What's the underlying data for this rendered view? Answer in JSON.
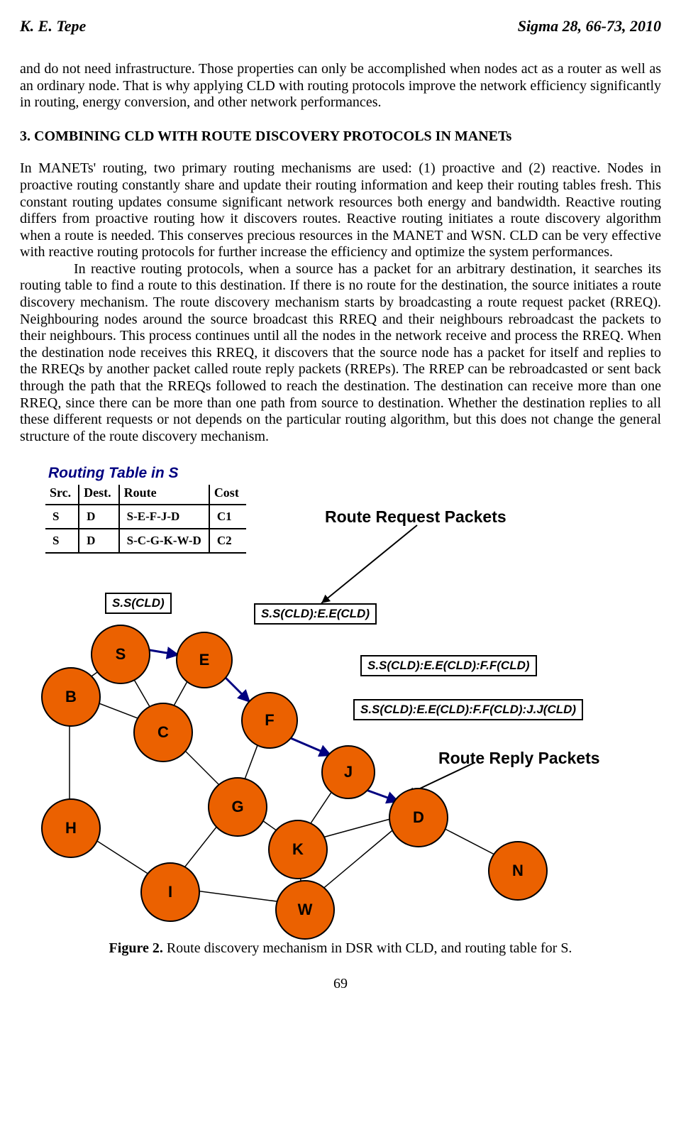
{
  "header": {
    "left": "K. E. Tepe",
    "right": "Sigma 28, 66-73, 2010"
  },
  "body": {
    "p1": "and do not need infrastructure. Those properties can only be accomplished when nodes act as a router as well as an ordinary node. That is why applying CLD with routing protocols improve the network efficiency significantly in routing, energy conversion, and other network performances.",
    "heading": "3. COMBINING CLD WITH ROUTE DISCOVERY PROTOCOLS IN MANETs",
    "p2": "In MANETs' routing, two primary routing mechanisms are used: (1) proactive and (2) reactive. Nodes in proactive routing constantly share and update their routing information and keep their routing tables fresh. This constant routing updates consume significant network resources both energy and bandwidth. Reactive routing differs from proactive routing how it discovers routes. Reactive routing initiates a route discovery algorithm when a route is needed. This conserves precious resources in the MANET and WSN. CLD can be very effective with reactive routing protocols for further increase the efficiency and optimize the system performances.",
    "p3": "In reactive routing protocols, when a source has a packet for an arbitrary destination, it searches its routing table to find a route to this destination. If there is no route for the destination, the source initiates a route discovery mechanism. The route discovery mechanism starts by broadcasting a route request packet (RREQ). Neighbouring nodes around the source broadcast this RREQ and their neighbours rebroadcast the packets to their neighbours. This process continues until all the nodes in the network receive and process the RREQ. When the destination node receives this RREQ, it discovers that the source node has a packet for itself and replies to the RREQs by another packet called route reply packets (RREPs). The RREP can be rebroadcasted or sent back through the path that the RREQs followed to reach the destination. The destination can receive more than one RREQ, since there can be more than one path from source to destination. Whether the destination replies to all these different requests or not depends on the particular routing algorithm, but this does not change the general structure of the route discovery mechanism."
  },
  "figure": {
    "routing_table_title": "Routing Table in S",
    "headers": [
      "Src.",
      "Dest.",
      "Route",
      "Cost"
    ],
    "rows": [
      [
        "S",
        "D",
        "S-E-F-J-D",
        "C1"
      ],
      [
        "S",
        "D",
        "S-C-G-K-W-D",
        "C2"
      ]
    ],
    "rreq_title": "Route Request Packets",
    "rrep_title": "Route Reply Packets",
    "labels": {
      "l1": "S.S(CLD)",
      "l2": "S.S(CLD):E.E(CLD)",
      "l3": "S.S(CLD):E.E(CLD):F.F(CLD)",
      "l4": "S.S(CLD):E.E(CLD):F.F(CLD):J.J(CLD)"
    },
    "nodes": [
      "S",
      "E",
      "F",
      "J",
      "B",
      "C",
      "G",
      "K",
      "H",
      "I",
      "W",
      "D",
      "N"
    ]
  },
  "caption": {
    "label": "Figure 2.",
    "text": " Route discovery mechanism in DSR with CLD, and routing table for S."
  },
  "pagenum": "69",
  "chart_data": {
    "type": "diagram",
    "description": "Network graph showing route discovery (RREQ / RREP) with CLD annotations, plus a routing table for node S.",
    "routing_table": {
      "columns": [
        "Src.",
        "Dest.",
        "Route",
        "Cost"
      ],
      "rows": [
        {
          "Src.": "S",
          "Dest.": "D",
          "Route": "S-E-F-J-D",
          "Cost": "C1"
        },
        {
          "Src.": "S",
          "Dest.": "D",
          "Route": "S-C-G-K-W-D",
          "Cost": "C2"
        }
      ]
    },
    "nodes": [
      "S",
      "E",
      "F",
      "J",
      "D",
      "B",
      "C",
      "G",
      "K",
      "H",
      "I",
      "W",
      "N"
    ],
    "edges_undirected": [
      [
        "S",
        "B"
      ],
      [
        "B",
        "H"
      ],
      [
        "H",
        "I"
      ],
      [
        "I",
        "W"
      ],
      [
        "W",
        "K"
      ],
      [
        "K",
        "G"
      ],
      [
        "G",
        "C"
      ],
      [
        "C",
        "B"
      ],
      [
        "C",
        "E"
      ],
      [
        "C",
        "S"
      ],
      [
        "G",
        "I"
      ],
      [
        "G",
        "F"
      ],
      [
        "K",
        "J"
      ],
      [
        "K",
        "D"
      ],
      [
        "W",
        "D"
      ],
      [
        "D",
        "N"
      ]
    ],
    "edges_rreq_path": [
      [
        "S",
        "E"
      ],
      [
        "E",
        "F"
      ],
      [
        "F",
        "J"
      ],
      [
        "J",
        "D"
      ]
    ],
    "edges_rrep_path": [
      [
        "D",
        "J"
      ],
      [
        "J",
        "F"
      ],
      [
        "F",
        "E"
      ],
      [
        "E",
        "S"
      ]
    ],
    "packet_labels_along_rreq": [
      "S.S(CLD)",
      "S.S(CLD):E.E(CLD)",
      "S.S(CLD):E.E(CLD):F.F(CLD)",
      "S.S(CLD):E.E(CLD):F.F(CLD):J.J(CLD)"
    ]
  }
}
